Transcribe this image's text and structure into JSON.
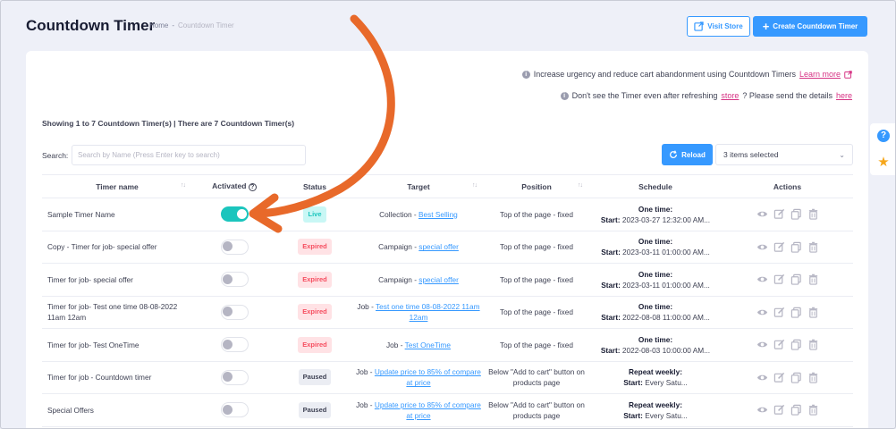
{
  "header": {
    "title": "Countdown Timer",
    "breadcrumb_home": "Home",
    "breadcrumb_sep": "-",
    "breadcrumb_current": "Countdown Timer",
    "visit_store_label": "Visit Store",
    "create_label": "Create Countdown Timer"
  },
  "info": {
    "line1_text": "Increase urgency and reduce cart abandonment using Countdown Timers",
    "line1_link": "Learn more",
    "line2_text_a": "Don't see the Timer even after refreshing",
    "line2_link_store": "store",
    "line2_text_b": "? Please send the details",
    "line2_link_here": "here"
  },
  "showing": "Showing 1 to 7 Countdown Timer(s) | There are 7 Countdown Timer(s)",
  "search": {
    "label": "Search:",
    "placeholder": "Search by Name (Press Enter key to search)"
  },
  "reload_label": "Reload",
  "items_selected": "3 items selected",
  "table": {
    "columns": [
      "Timer name",
      "Activated",
      "Status",
      "Target",
      "Position",
      "Schedule",
      "Actions"
    ],
    "rows": [
      {
        "name": "Sample Timer Name",
        "activated": true,
        "status": "Live",
        "status_kind": "live",
        "target_prefix": "Collection - ",
        "target_link": "Best Selling",
        "position": "Top of the page - fixed",
        "schedule_title": "One time:",
        "schedule_label": "Start:",
        "schedule_value": " 2023-03-27 12:32:00 AM..."
      },
      {
        "name": "Copy - Timer for job- special offer",
        "activated": false,
        "status": "Expired",
        "status_kind": "expired",
        "target_prefix": "Campaign - ",
        "target_link": "special offer",
        "position": "Top of the page - fixed",
        "schedule_title": "One time:",
        "schedule_label": "Start:",
        "schedule_value": " 2023-03-11 01:00:00 AM..."
      },
      {
        "name": "Timer for job- special offer",
        "activated": false,
        "status": "Expired",
        "status_kind": "expired",
        "target_prefix": "Campaign - ",
        "target_link": "special offer",
        "position": "Top of the page - fixed",
        "schedule_title": "One time:",
        "schedule_label": "Start:",
        "schedule_value": " 2023-03-11 01:00:00 AM..."
      },
      {
        "name": "Timer for job- Test one time 08-08-2022 11am 12am",
        "activated": false,
        "status": "Expired",
        "status_kind": "expired",
        "target_prefix": "Job - ",
        "target_link": "Test one time 08-08-2022 11am 12am",
        "position": "Top of the page - fixed",
        "schedule_title": "One time:",
        "schedule_label": "Start:",
        "schedule_value": " 2022-08-08 11:00:00 AM..."
      },
      {
        "name": "Timer for job- Test OneTime",
        "activated": false,
        "status": "Expired",
        "status_kind": "expired",
        "target_prefix": "Job - ",
        "target_link": "Test OneTime",
        "position": "Top of the page - fixed",
        "schedule_title": "One time:",
        "schedule_label": "Start:",
        "schedule_value": " 2022-08-03 10:00:00 AM..."
      },
      {
        "name": "Timer for job - Countdown timer",
        "activated": false,
        "status": "Paused",
        "status_kind": "paused",
        "target_prefix": "Job - ",
        "target_link": "Update price to 85% of compare at price",
        "position": "Below \"Add to cart\" button on products page",
        "schedule_title": "Repeat weekly:",
        "schedule_label": "Start:",
        "schedule_value": " Every Satu..."
      },
      {
        "name": "Special Offers",
        "activated": false,
        "status": "Paused",
        "status_kind": "paused",
        "target_prefix": "Job - ",
        "target_link": "Update price to 85% of compare at price",
        "position": "Below \"Add to cart\" button on products page",
        "schedule_title": "Repeat weekly:",
        "schedule_label": "Start:",
        "schedule_value": " Every Satu..."
      }
    ]
  },
  "colors": {
    "primary": "#3699ff",
    "annotation_arrow": "#e8692a",
    "toggle_on": "#1bc5bd",
    "expired": "#f64e60",
    "star": "#f6a71b"
  },
  "icons": {
    "visit_store": "external-link-icon",
    "create": "plus-icon",
    "reload": "refresh-icon",
    "info": "info-icon",
    "actions": [
      "eye-icon",
      "edit-icon",
      "copy-icon",
      "trash-icon"
    ],
    "side": [
      "help-icon",
      "star-icon"
    ]
  }
}
